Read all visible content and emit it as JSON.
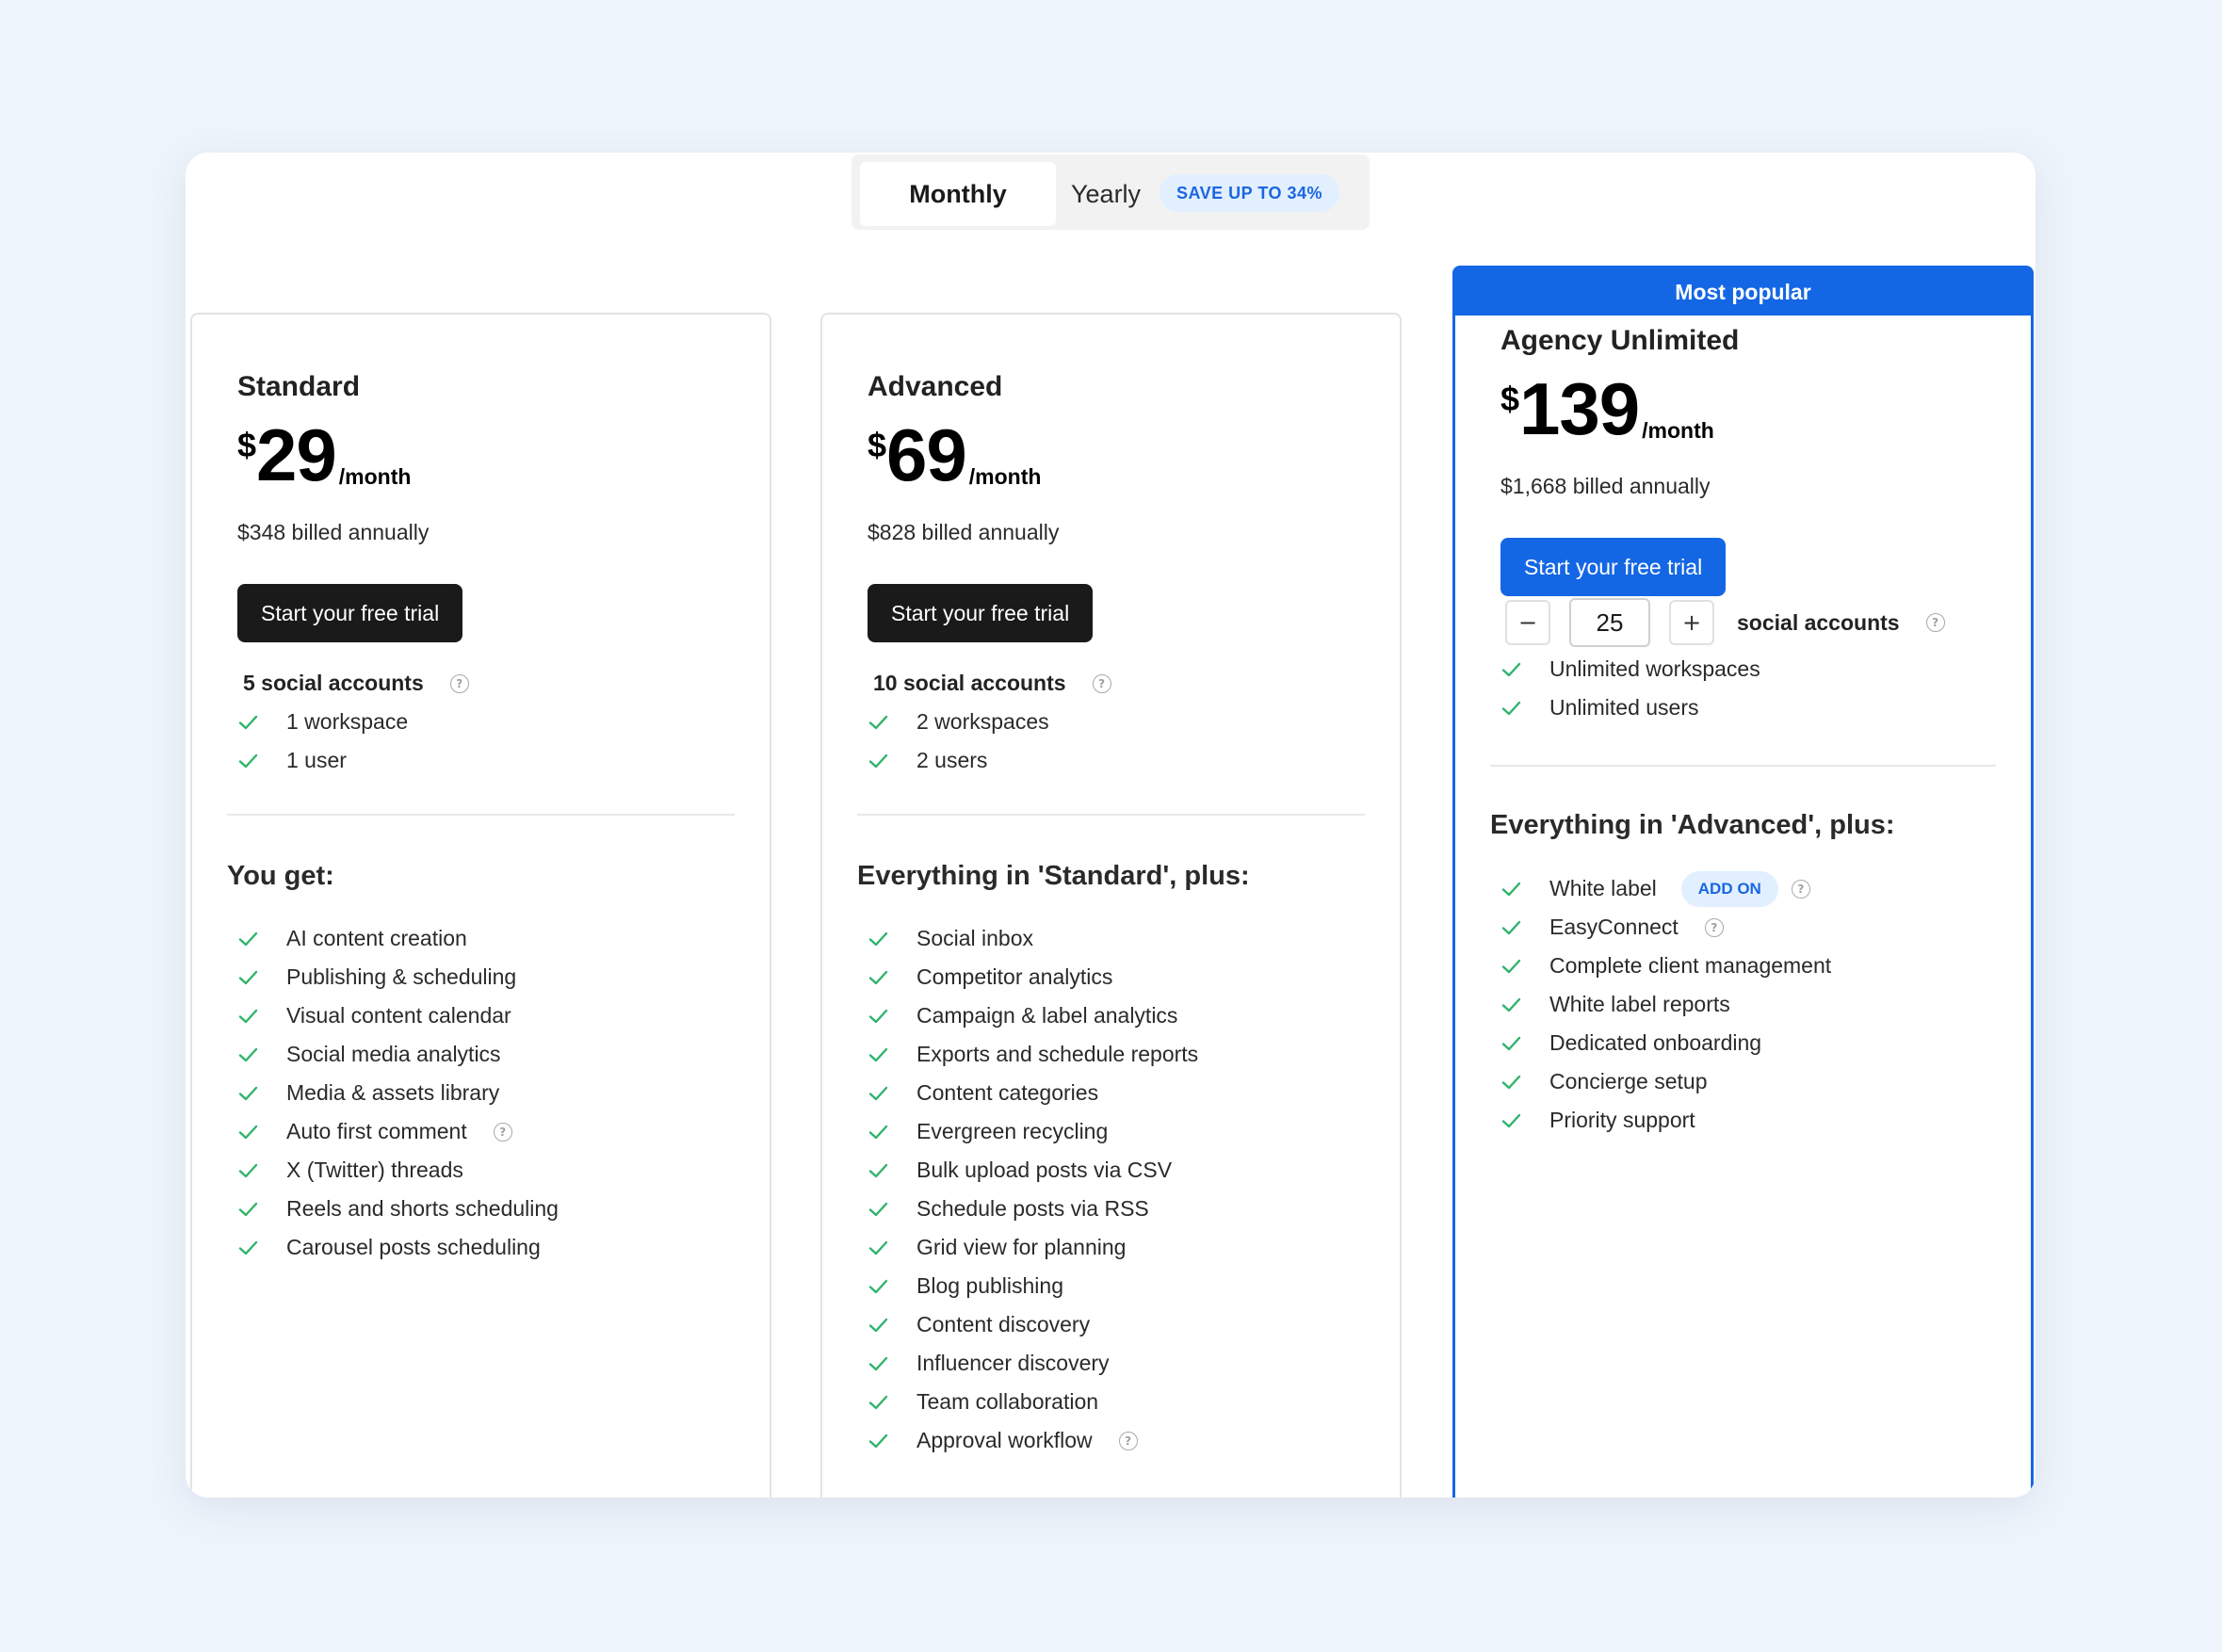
{
  "billing_toggle": {
    "monthly_label": "Monthly",
    "yearly_label": "Yearly",
    "save_badge": "SAVE UP TO 34%",
    "selected": "Monthly"
  },
  "colors": {
    "accent": "#1467e4",
    "dark_button": "#1a1a1a",
    "check": "#2fb36b",
    "badge_bg": "#e2efff"
  },
  "plans": [
    {
      "name": "Standard",
      "currency": "$",
      "price": "29",
      "period": "/month",
      "billed": "$348 billed annually",
      "cta": "Start your free trial",
      "accounts": "5 social accounts",
      "limits": [
        "1 workspace",
        "1 user"
      ],
      "section_title": "You get:",
      "features": [
        {
          "label": "AI content creation"
        },
        {
          "label": "Publishing & scheduling"
        },
        {
          "label": "Visual content calendar"
        },
        {
          "label": "Social media analytics"
        },
        {
          "label": "Media & assets library"
        },
        {
          "label": "Auto first comment",
          "info": true
        },
        {
          "label": "X (Twitter) threads"
        },
        {
          "label": "Reels and shorts scheduling"
        },
        {
          "label": "Carousel posts scheduling"
        }
      ]
    },
    {
      "name": "Advanced",
      "currency": "$",
      "price": "69",
      "period": "/month",
      "billed": "$828 billed annually",
      "cta": "Start your free trial",
      "accounts": "10 social accounts",
      "limits": [
        "2 workspaces",
        "2 users"
      ],
      "section_title": "Everything in 'Standard', plus:",
      "features": [
        {
          "label": "Social inbox"
        },
        {
          "label": "Competitor analytics"
        },
        {
          "label": "Campaign & label analytics"
        },
        {
          "label": "Exports and schedule reports"
        },
        {
          "label": "Content categories"
        },
        {
          "label": "Evergreen recycling"
        },
        {
          "label": "Bulk upload posts via CSV"
        },
        {
          "label": "Schedule posts via RSS"
        },
        {
          "label": "Grid view for planning"
        },
        {
          "label": "Blog publishing"
        },
        {
          "label": "Content discovery"
        },
        {
          "label": "Influencer discovery"
        },
        {
          "label": "Team collaboration"
        },
        {
          "label": "Approval workflow",
          "info": true
        }
      ]
    },
    {
      "name": "Agency Unlimited",
      "banner": "Most popular",
      "currency": "$",
      "price": "139",
      "period": "/month",
      "billed": "$1,668 billed annually",
      "cta": "Start your free trial",
      "stepper": {
        "minus": "−",
        "plus": "+",
        "value": "25",
        "label": "social accounts"
      },
      "limits": [
        "Unlimited workspaces",
        "Unlimited users"
      ],
      "section_title": "Everything in 'Advanced', plus:",
      "features": [
        {
          "label": "White label",
          "addon": "ADD ON",
          "info": true
        },
        {
          "label": "EasyConnect",
          "info": true
        },
        {
          "label": "Complete client management"
        },
        {
          "label": "White label reports"
        },
        {
          "label": "Dedicated onboarding"
        },
        {
          "label": "Concierge setup"
        },
        {
          "label": "Priority support"
        }
      ]
    }
  ]
}
